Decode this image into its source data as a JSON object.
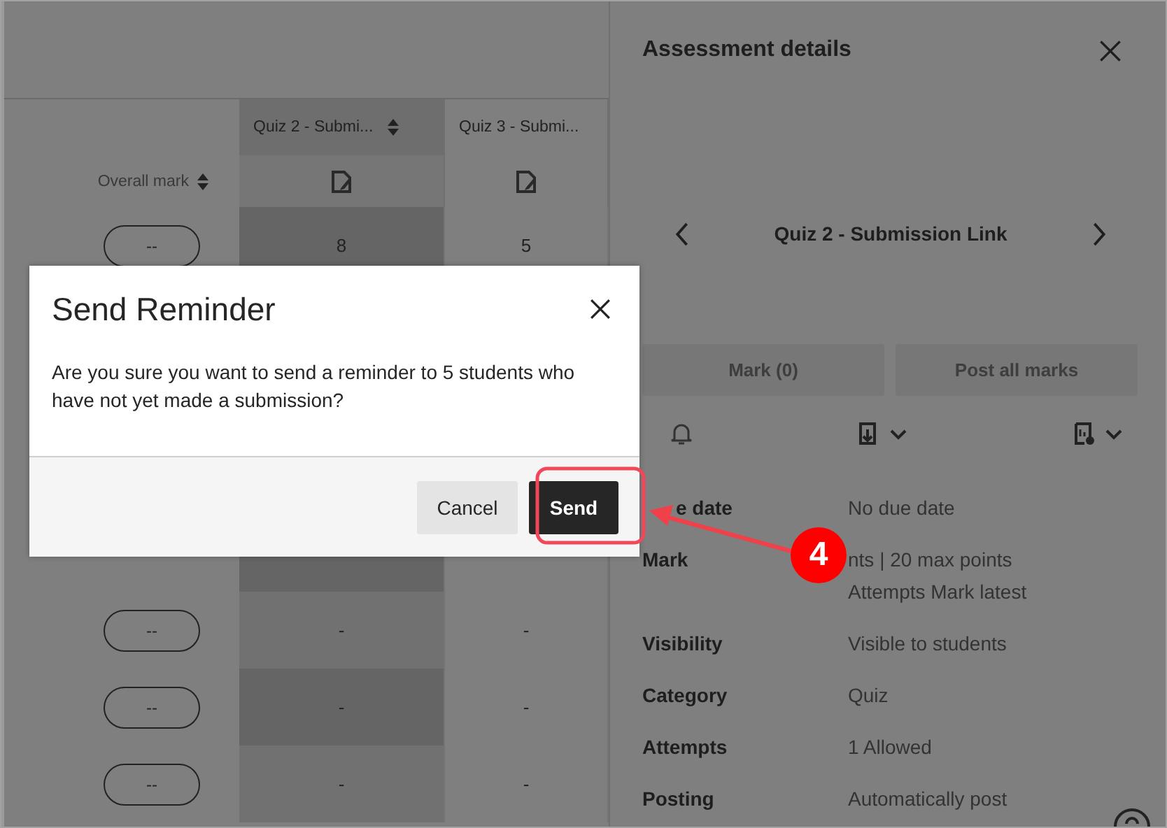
{
  "grid": {
    "columns": [
      {
        "label": "Overall mark",
        "sortable": true,
        "selected": false
      },
      {
        "label": "Quiz 2 - Submi...",
        "sortable": true,
        "selected": true
      },
      {
        "label": "Quiz 3 - Submi...",
        "sortable": false,
        "selected": false
      }
    ],
    "rows": [
      {
        "cells": [
          "--",
          "8",
          "5"
        ]
      },
      {
        "cells": [
          "--",
          "-",
          "-"
        ]
      },
      {
        "cells": [
          "--",
          "-",
          "-"
        ]
      },
      {
        "cells": [
          "--",
          "-",
          "-"
        ]
      }
    ]
  },
  "panel": {
    "title": "Assessment details",
    "item": "Quiz 2 - Submission Link",
    "buttons": [
      {
        "label": "Mark (0)",
        "disabled": true
      },
      {
        "label": "Post all marks",
        "disabled": true
      }
    ],
    "details": [
      {
        "label": "e date",
        "lines": [
          "No due date"
        ]
      },
      {
        "label": "Mark",
        "lines": [
          "nts | 20 max points",
          "Attempts Mark latest"
        ]
      },
      {
        "label": "Visibility",
        "lines": [
          "Visible to students"
        ]
      },
      {
        "label": "Category",
        "lines": [
          "Quiz"
        ]
      },
      {
        "label": "Attempts",
        "lines": [
          "1 Allowed"
        ]
      },
      {
        "label": "Posting",
        "lines": [
          "Automatically post"
        ]
      }
    ]
  },
  "dialog": {
    "title": "Send Reminder",
    "message": "Are you sure you want to send a reminder to 5 students who have not yet made a submission?",
    "buttons": [
      {
        "label": "Cancel",
        "kind": "secondary"
      },
      {
        "label": "Send",
        "kind": "primary"
      }
    ]
  },
  "annotation": {
    "number": "4"
  }
}
